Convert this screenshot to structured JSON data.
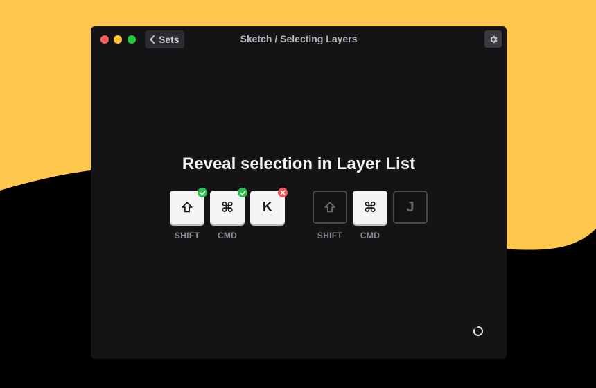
{
  "window": {
    "back_label": "Sets",
    "title": "Sketch / Selecting Layers"
  },
  "prompt": {
    "heading": "Reveal selection in Layer List"
  },
  "attempt_keys": [
    {
      "glyph": "⇧",
      "label": "SHIFT",
      "status": "correct"
    },
    {
      "glyph": "⌘",
      "label": "CMD",
      "status": "correct"
    },
    {
      "glyph": "K",
      "label": "",
      "status": "wrong"
    }
  ],
  "answer_keys": [
    {
      "glyph": "⇧",
      "label": "SHIFT"
    },
    {
      "glyph": "⌘",
      "label": "CMD"
    },
    {
      "glyph": "J",
      "label": ""
    }
  ],
  "icons": [
    "close-icon",
    "minimize-icon",
    "zoom-icon",
    "chevron-left-icon",
    "gear-icon",
    "check-icon",
    "x-icon",
    "spinner-icon"
  ],
  "colors": {
    "accent_yellow": "#fdc74e",
    "window_bg": "#141316",
    "correct": "#2fbf4f",
    "wrong": "#f05a5a"
  }
}
